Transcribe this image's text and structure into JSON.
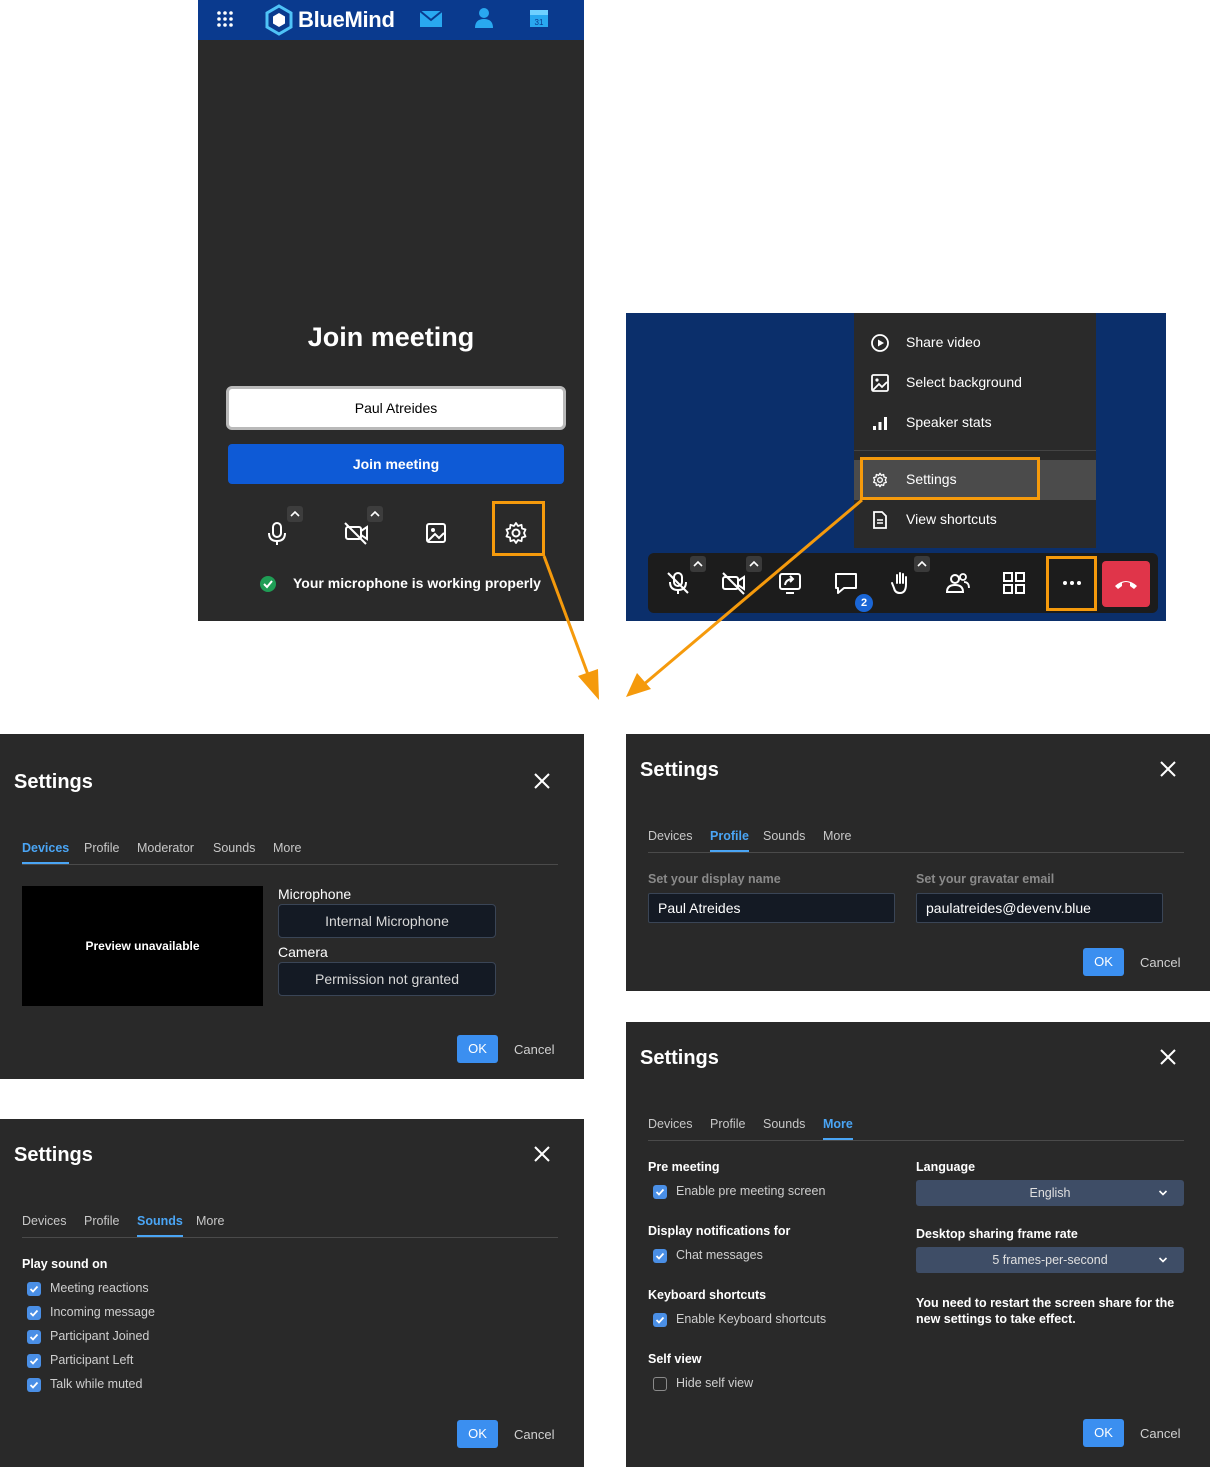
{
  "join_panel": {
    "brand": "BlueMind",
    "title": "Join meeting",
    "name_value": "Paul Atreides",
    "join_label": "Join meeting",
    "mic_status": "Your microphone is working properly"
  },
  "meeting_panel": {
    "menu_items": [
      "Share video",
      "Select background",
      "Speaker stats",
      "Settings",
      "View shortcuts"
    ],
    "chat_badge": "2"
  },
  "devices_dialog": {
    "title": "Settings",
    "tabs": [
      "Devices",
      "Profile",
      "Moderator",
      "Sounds",
      "More"
    ],
    "active_tab": "Devices",
    "preview_text": "Preview unavailable",
    "microphone_label": "Microphone",
    "microphone_value": "Internal Microphone",
    "camera_label": "Camera",
    "camera_value": "Permission not granted",
    "ok": "OK",
    "cancel": "Cancel"
  },
  "profile_dialog": {
    "title": "Settings",
    "tabs": [
      "Devices",
      "Profile",
      "Sounds",
      "More"
    ],
    "active_tab": "Profile",
    "name_label": "Set your display name",
    "name_value": "Paul Atreides",
    "email_label": "Set your gravatar email",
    "email_value": "paulatreides@devenv.blue",
    "ok": "OK",
    "cancel": "Cancel"
  },
  "sounds_dialog": {
    "title": "Settings",
    "tabs": [
      "Devices",
      "Profile",
      "Sounds",
      "More"
    ],
    "active_tab": "Sounds",
    "section": "Play sound on",
    "options": [
      "Meeting reactions",
      "Incoming message",
      "Participant Joined",
      "Participant Left",
      "Talk while muted"
    ],
    "ok": "OK",
    "cancel": "Cancel"
  },
  "more_dialog": {
    "title": "Settings",
    "tabs": [
      "Devices",
      "Profile",
      "Sounds",
      "More"
    ],
    "active_tab": "More",
    "pre_meeting_label": "Pre meeting",
    "pre_meeting_option": "Enable pre meeting screen",
    "notifications_label": "Display notifications for",
    "notifications_option": "Chat messages",
    "shortcuts_label": "Keyboard shortcuts",
    "shortcuts_option": "Enable Keyboard shortcuts",
    "self_view_label": "Self view",
    "self_view_option": "Hide self view",
    "language_label": "Language",
    "language_value": "English",
    "frame_rate_label": "Desktop sharing frame rate",
    "frame_rate_value": "5 frames-per-second",
    "frame_rate_note": "You need to restart the screen share for the new settings to take effect.",
    "ok": "OK",
    "cancel": "Cancel"
  },
  "colors": {
    "highlight": "#f59a0c",
    "accent": "#3b8ff0",
    "topbar": "#0a3a8e",
    "hangup": "#e0354a"
  }
}
